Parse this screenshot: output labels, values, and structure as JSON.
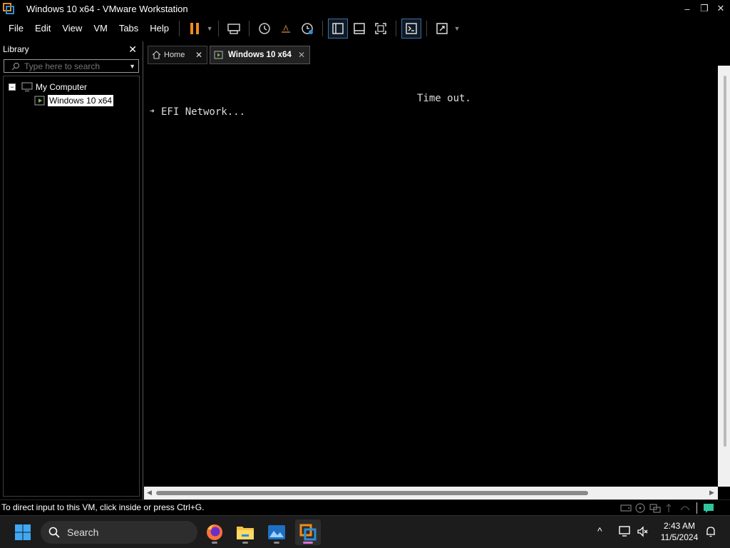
{
  "window": {
    "title": "Windows 10 x64 - VMware Workstation",
    "minimize": "–",
    "maximize": "❐",
    "close": "✕"
  },
  "menu": [
    "File",
    "Edit",
    "View",
    "VM",
    "Tabs",
    "Help"
  ],
  "library": {
    "title": "Library",
    "close": "✕",
    "search_placeholder": "Type here to search",
    "tree": {
      "expander": "−",
      "root": "My Computer",
      "child": "Windows 10 x64"
    }
  },
  "tabs": {
    "home_label": "Home",
    "vm_label": "Windows 10 x64",
    "close": "✕"
  },
  "console": {
    "line1": "Time out.",
    "arrow": "➜",
    "line2": "EFI Network..."
  },
  "status": {
    "text": "To direct input to this VM, click inside or press Ctrl+G."
  },
  "taskbar": {
    "search_label": "Search",
    "time": "2:43 AM",
    "date": "11/5/2024",
    "chevron": "^"
  },
  "colors": {
    "accent_orange": "#f08c1c",
    "vmware_blue": "#2a8fd6",
    "selection_bg": "#ffffff"
  }
}
